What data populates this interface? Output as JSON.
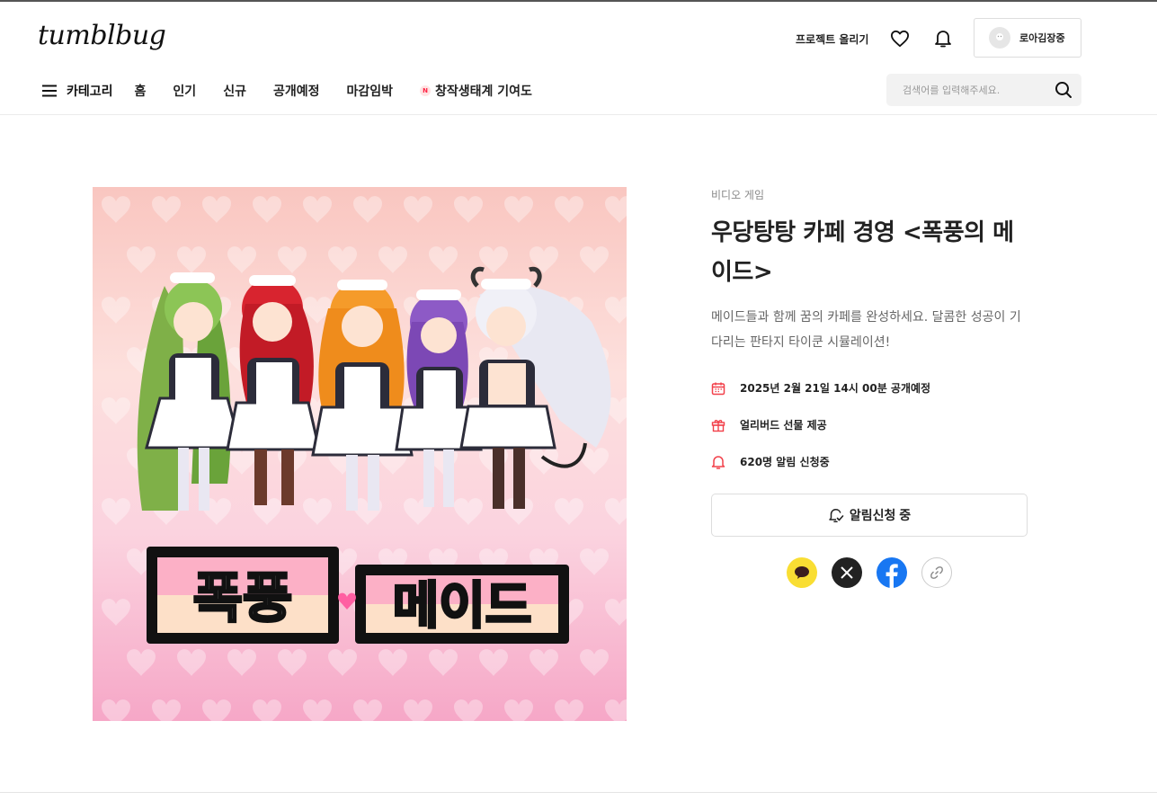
{
  "header": {
    "logo": "tumblbug",
    "upload_label": "프로젝트 올리기",
    "profile_name": "로아김장중",
    "search_placeholder": "검색어를 입력해주세요."
  },
  "nav": {
    "menu_label": "카테고리",
    "items": [
      "홈",
      "인기",
      "신규",
      "공개예정",
      "마감임박"
    ],
    "special_item": {
      "badge": "N",
      "label": "창작생태계 기여도"
    }
  },
  "project": {
    "category": "비디오 게임",
    "title": "우당탕탕 카페 경영 <폭풍의 메이드>",
    "summary": "메이드들과 함께 꿈의 카페를 완성하세요. 달콤한 성공이 기다리는 판타지 타이쿤 시뮬레이션!",
    "image_title_text": "폭풍의 메이드",
    "meta": {
      "launch": "2025년 2월 21일 14시 00분 공개예정",
      "gift": "얼리버드 선물 제공",
      "alerts": "620명 알림 신청중"
    },
    "notify_button": "알림신청 중"
  },
  "colors": {
    "accent": "#f2404a",
    "kakao": "#f9de33",
    "facebook": "#1877f2"
  },
  "icons": {
    "share": [
      "kakao-icon",
      "x-icon",
      "facebook-icon",
      "link-icon"
    ]
  }
}
